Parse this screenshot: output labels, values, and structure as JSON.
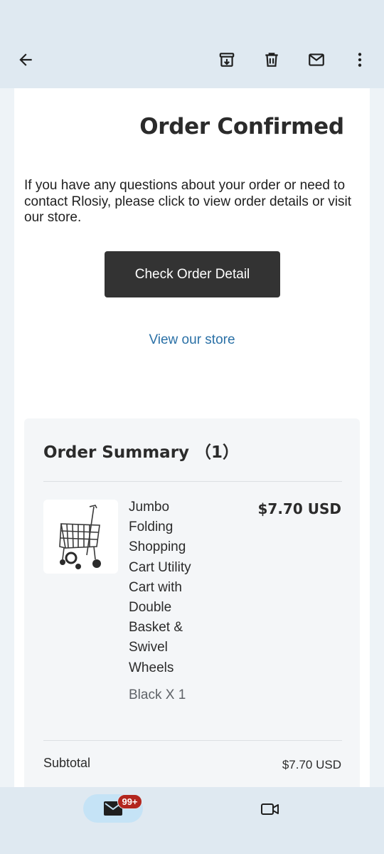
{
  "toolbar": {
    "icons": [
      "back-arrow-icon",
      "archive-icon",
      "delete-icon",
      "mark-unread-icon",
      "more-vert-icon"
    ]
  },
  "email": {
    "title": "Order Confirmed",
    "intro": "If you have any questions about your order or need to contact Rlosiy, please click to view order details or visit our store.",
    "cta_label": "Check Order Detail",
    "store_link": "View our store"
  },
  "order_summary": {
    "title": "Order Summary （1）",
    "items": [
      {
        "name": "Jumbo Folding Shopping Cart Utility Cart with Double Basket & Swivel Wheels",
        "variant": "Black X 1",
        "price": "$7.70 USD"
      }
    ],
    "subtotal_label": "Subtotal",
    "subtotal_value": "$7.70 USD"
  },
  "bottom_nav": {
    "mail_badge": "99+",
    "icons": [
      "mail-icon",
      "video-call-icon"
    ]
  },
  "colors": {
    "chrome_bg": "#dfe9f1",
    "button_bg": "#333333",
    "link": "#2a70a6",
    "badge": "#b3261e",
    "nav_active": "#c5e3f6"
  }
}
